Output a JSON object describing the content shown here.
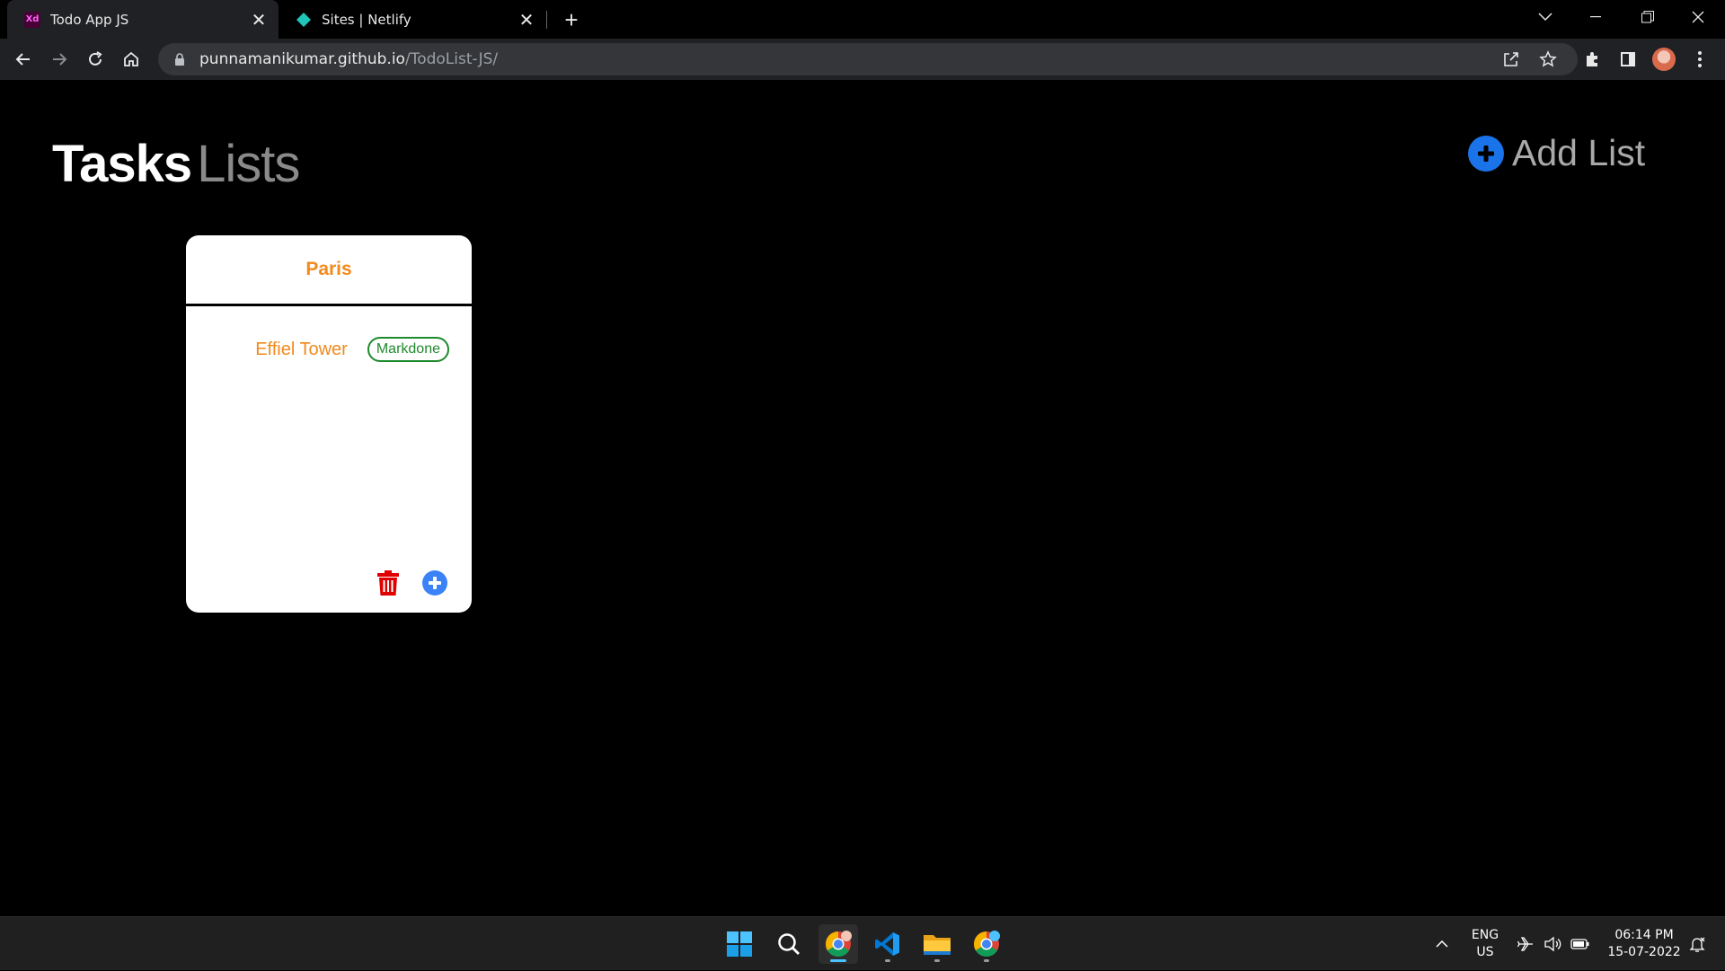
{
  "browser": {
    "tabs": [
      {
        "title": "Todo App JS",
        "active": true,
        "favicon": "adobe-xd-icon"
      },
      {
        "title": "Sites | Netlify",
        "active": false,
        "favicon": "netlify-icon"
      }
    ],
    "url_host": "punnamanikumar.github.io",
    "url_path": "/TodoList-JS/"
  },
  "page": {
    "heading_tasks": "Tasks",
    "heading_lists": "Lists",
    "add_list_label": "Add List"
  },
  "lists": [
    {
      "title": "Paris",
      "tasks": [
        {
          "text": "Effiel Tower",
          "action_label": "Markdone"
        }
      ]
    }
  ],
  "taskbar": {
    "language": "ENG",
    "region": "US",
    "time": "06:14 PM",
    "date": "15-07-2022"
  },
  "colors": {
    "accent_orange": "#f28a1c",
    "markdone_green": "#1e8a2c",
    "add_blue": "#1a73e8",
    "delete_red": "#e00000"
  }
}
